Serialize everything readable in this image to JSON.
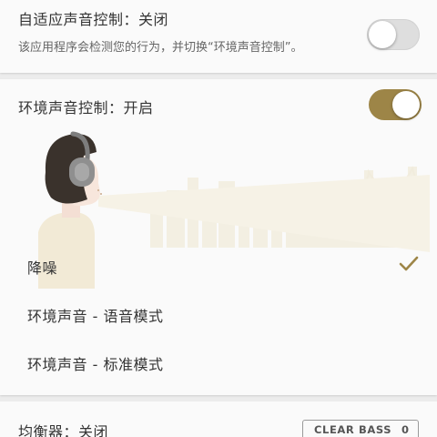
{
  "adaptive": {
    "title": "自适应声音控制：关闭",
    "description": "该应用程序会检测您的行为，并切换“环境声音控制”。",
    "toggle_state": "off"
  },
  "ambient": {
    "title": "环境声音控制：开启",
    "toggle_state": "on",
    "options": [
      {
        "label": "降噪",
        "selected": true
      },
      {
        "label": "环境声音 - 语音模式",
        "selected": false
      },
      {
        "label": "环境声音 - 标准模式",
        "selected": false
      }
    ]
  },
  "equalizer": {
    "title": "均衡器：关闭",
    "clear_bass_label": "CLEAR BASS",
    "clear_bass_value": "0"
  },
  "colors": {
    "accent": "#9d8547",
    "background": "#ececec",
    "card": "#fafafa"
  },
  "icons": [
    "headphone-person-illustration",
    "checkmark-icon"
  ]
}
